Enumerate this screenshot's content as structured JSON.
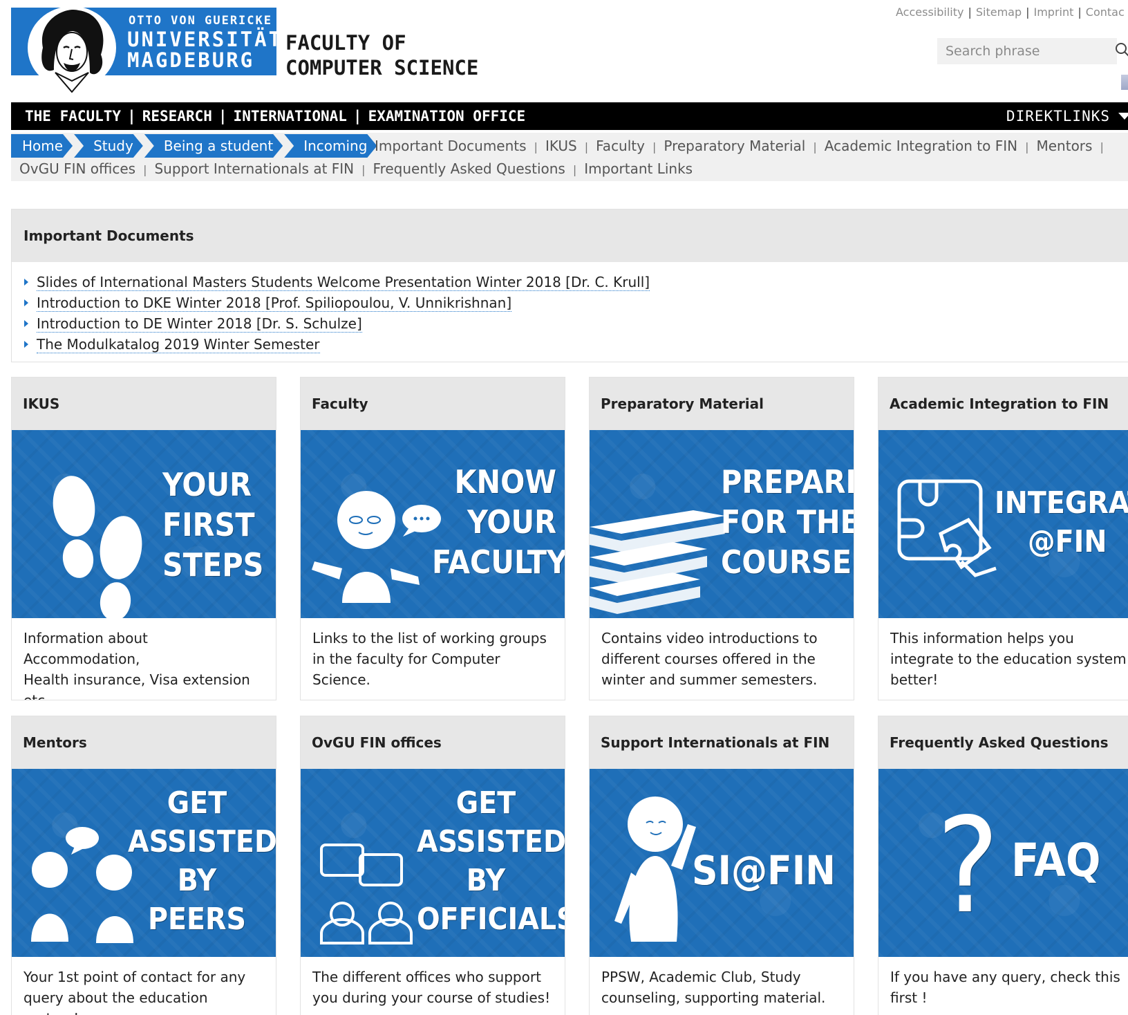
{
  "header": {
    "university_line1": "OTTO VON GUERICKE",
    "university_line2": "UNIVERSITÄT",
    "university_line3": "MAGDEBURG",
    "faculty_line1": "FACULTY OF",
    "faculty_line2": "COMPUTER SCIENCE",
    "brand_color": "#1f75c8"
  },
  "toplinks": [
    "Accessibility",
    "Sitemap",
    "Imprint",
    "Contac"
  ],
  "search": {
    "placeholder": "Search phrase"
  },
  "mainnav": {
    "items": [
      "THE FACULTY",
      "RESEARCH",
      "INTERNATIONAL",
      "EXAMINATION OFFICE"
    ],
    "direktlinks": "DIREKTLINKS"
  },
  "breadcrumb": [
    "Home",
    "Study",
    "Being a student",
    "Incoming"
  ],
  "subnav": {
    "row1": [
      "Important Documents",
      "IKUS",
      "Faculty",
      "Preparatory Material",
      "Academic Integration to FIN",
      "Mentors"
    ],
    "row2": [
      "OvGU FIN offices",
      "Support Internationals at FIN",
      "Frequently Asked Questions",
      "Important Links"
    ]
  },
  "documents": {
    "title": "Important Documents",
    "items": [
      "Slides of International Masters Students Welcome Presentation Winter 2018 [Dr. C. Krull]",
      "Introduction to DKE Winter 2018 [Prof. Spiliopoulou, V. Unnikrishnan]",
      "Introduction to DE Winter 2018 [Dr. S. Schulze]",
      "The Modulkatalog 2019 Winter Semester"
    ]
  },
  "cards": [
    {
      "title": "IKUS",
      "image_text": [
        "YOUR",
        "FIRST",
        "STEPS"
      ],
      "icon": "footprints-icon",
      "desc": [
        "Information about Accommodation,",
        "Health insurance, Visa extension",
        "etc."
      ]
    },
    {
      "title": "Faculty",
      "image_text": [
        "KNOW",
        "YOUR",
        "FACULTY"
      ],
      "icon": "person-speech-icon",
      "desc": [
        "Links to the list of working groups",
        "in the faculty for Computer",
        "Science."
      ]
    },
    {
      "title": "Preparatory Material",
      "image_text": [
        "PREPARE",
        "FOR THE",
        "COURSE"
      ],
      "icon": "books-icon",
      "desc": [
        "Contains video introductions to",
        "different courses offered in the",
        "winter and summer semesters."
      ]
    },
    {
      "title": "Academic Integration to FIN",
      "image_text": [
        "INTEGRATI",
        "@FIN"
      ],
      "icon": "puzzle-icon",
      "desc": [
        "This information helps you",
        "integrate to the education system",
        "better!"
      ]
    },
    {
      "title": "Mentors",
      "image_text": [
        "GET",
        "ASSISTED",
        "BY",
        "PEERS"
      ],
      "icon": "peers-icon",
      "desc": [
        "Your 1st point of contact for any",
        "query about the education system!"
      ]
    },
    {
      "title": "OvGU FIN offices",
      "image_text": [
        "GET",
        "ASSISTED",
        "BY",
        "OFFICIALS"
      ],
      "icon": "officials-icon",
      "desc": [
        "The different offices who support",
        "you during your course of studies!"
      ]
    },
    {
      "title": "Support Internationals at FIN",
      "image_text": [
        "SI@FIN"
      ],
      "icon": "person-raising-hand-icon",
      "desc": [
        "PPSW, Academic Club, Study",
        "counseling, supporting material."
      ]
    },
    {
      "title": "Frequently Asked Questions",
      "image_text": [
        "?",
        "FAQ"
      ],
      "icon": "question-mark-icon",
      "desc": [
        "If you have any query, check this",
        "first !"
      ]
    }
  ]
}
